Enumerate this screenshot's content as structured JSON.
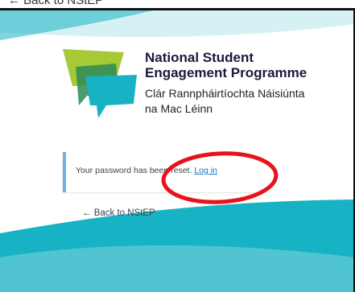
{
  "top_link": {
    "label": "← Back to NStEP"
  },
  "brand": {
    "title_line1": "National Student",
    "title_line2": "Engagement Programme",
    "subtitle_line1": "Clár Rannpháirtíochta Náisiúnta",
    "subtitle_line2": "na Mac Léinn"
  },
  "notice": {
    "message": "Your password has been reset.",
    "link_label": "Log in"
  },
  "footer_link": {
    "label": "← Back to NStEP"
  },
  "colors": {
    "teal": "#17b3c4",
    "lime": "#a6c938",
    "green": "#6eb33f",
    "notice_border": "#72aee6",
    "link": "#2271b1",
    "annotation": "#e8121a"
  }
}
